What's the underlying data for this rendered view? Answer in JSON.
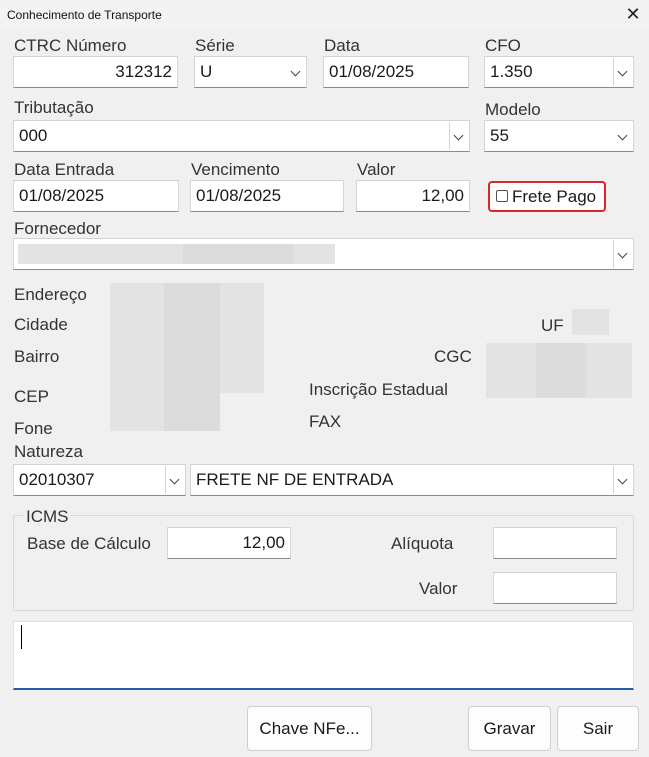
{
  "window": {
    "title": "Conhecimento de Transporte"
  },
  "labels": {
    "ctrc": "CTRC Número",
    "serie": "Série",
    "data": "Data",
    "cfo": "CFO",
    "tributacao": "Tributação",
    "modelo": "Modelo",
    "data_entrada": "Data Entrada",
    "vencimento": "Vencimento",
    "valor": "Valor",
    "fornecedor": "Fornecedor",
    "endereco": "Endereço",
    "cidade": "Cidade",
    "uf": "UF",
    "bairro": "Bairro",
    "cgc": "CGC",
    "cep": "CEP",
    "inscricao": "Inscrição Estadual",
    "fone": "Fone",
    "fax": "FAX",
    "natureza": "Natureza"
  },
  "fields": {
    "ctrc": "312312",
    "serie": "U",
    "data": "01/08/2025",
    "cfo": "1.350",
    "tributacao": "000",
    "modelo": "55",
    "data_entrada": "01/08/2025",
    "vencimento": "01/08/2025",
    "valor": "12,00",
    "natureza_code": "02010307",
    "natureza_desc": "FRETE NF DE ENTRADA"
  },
  "frete_pago": {
    "label": "Frete Pago",
    "checked": false
  },
  "icms": {
    "title": "ICMS",
    "base_label": "Base de Cálculo",
    "base_value": "12,00",
    "aliquota_label": "Alíquota",
    "aliquota_value": "",
    "valor_label": "Valor",
    "valor_value": ""
  },
  "buttons": {
    "chave": "Chave NFe...",
    "gravar": "Gravar",
    "sair": "Sair"
  },
  "icons": {
    "close": "✕"
  },
  "colors": {
    "highlight_border": "#d9262b",
    "focus_underline": "#1f5fa6"
  }
}
